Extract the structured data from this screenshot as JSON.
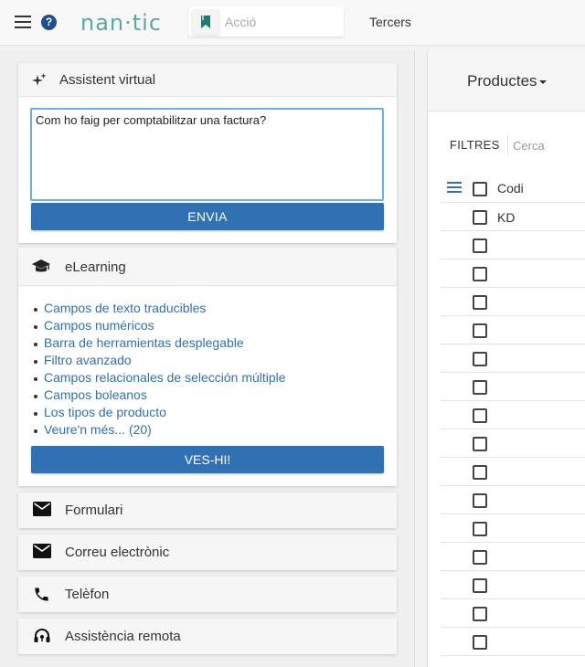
{
  "navbar": {
    "logo": "nan·tic",
    "search_placeholder": "Acció",
    "tercers": "Tercers"
  },
  "assistant": {
    "title": "Assistent virtual",
    "question": "Com ho faig per comptabilitzar una factura?",
    "send_label": "ENVIA"
  },
  "elearning": {
    "title": "eLearning",
    "links": [
      "Campos de texto traducibles",
      "Campos numéricos",
      "Barra de herramientas desplegable",
      "Filtro avanzado",
      "Campos relacionales de selección múltiple",
      "Campos boleanos",
      "Los tipos de producto",
      "Veure'n més... (20)"
    ],
    "see_label": "VES-HI!"
  },
  "contacts": {
    "form": "Formulari",
    "email": "Correu electrònic",
    "phone": "Telèfon",
    "remote": "Assistència remota"
  },
  "products": {
    "title": "Productes",
    "filter_label": "FILTRES",
    "filter_placeholder": "Cerca",
    "column_header": "Codi",
    "rows": [
      "KD",
      "",
      "",
      "",
      "",
      "",
      "",
      "",
      "",
      "",
      "",
      "",
      "",
      "",
      "",
      ""
    ]
  },
  "colors": {
    "accent": "#3071b3",
    "logo": "#5aa89e",
    "help": "#1e4e8c"
  }
}
